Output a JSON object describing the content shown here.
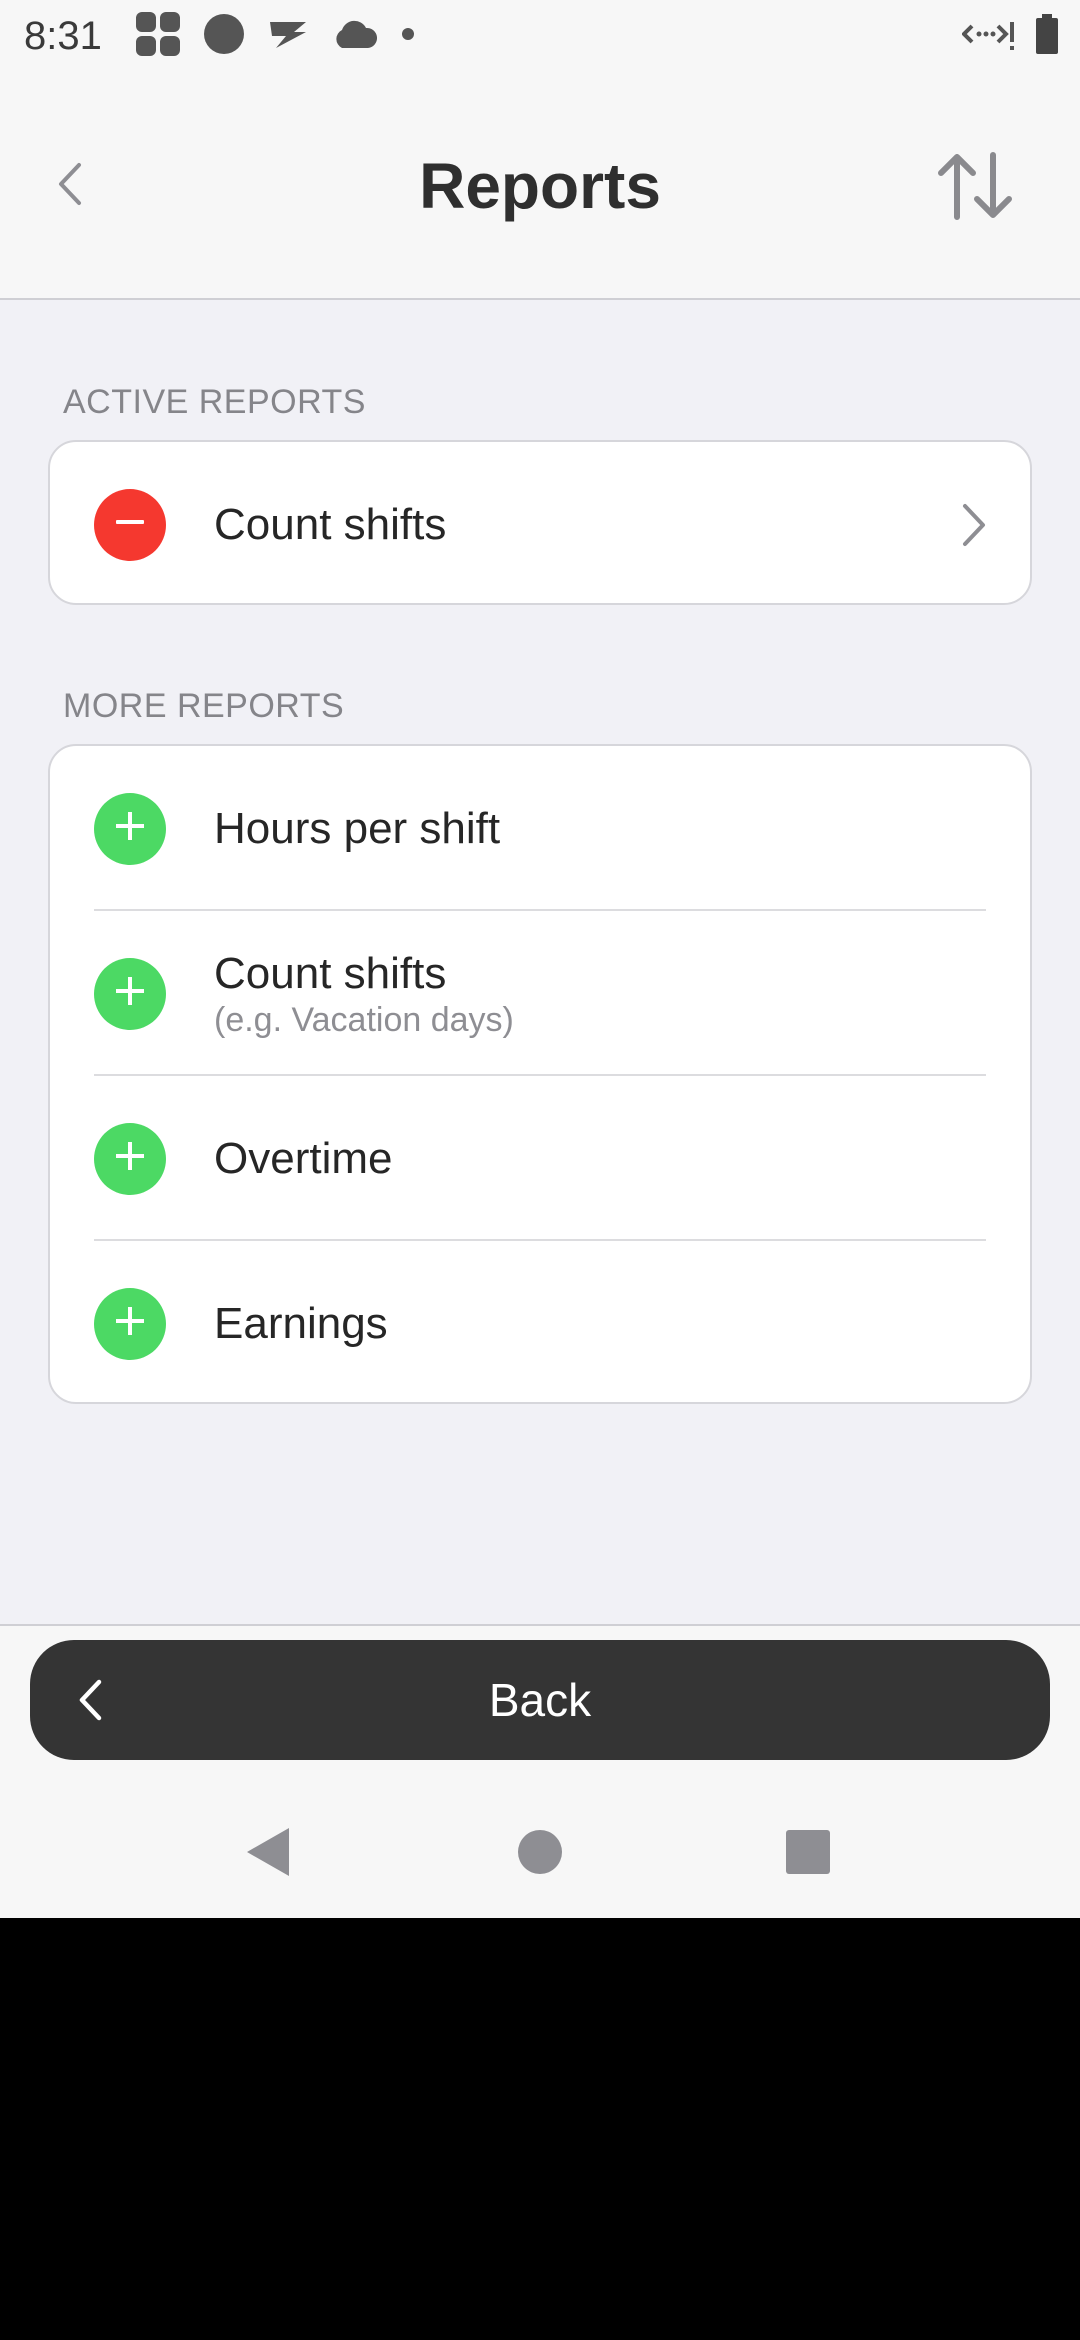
{
  "status_bar": {
    "time": "8:31",
    "left_icons": [
      "grid-app-icon",
      "circle-app-icon",
      "fast-forward-app-icon",
      "cloud-icon",
      "dot-icon"
    ],
    "right_icons": [
      "data-sync-icon",
      "battery-icon"
    ]
  },
  "header": {
    "title": "Reports",
    "back_icon": "chevron-left-icon",
    "sort_icon": "sort-arrows-icon"
  },
  "active_reports": {
    "label": "ACTIVE REPORTS",
    "items": [
      {
        "title": "Count shifts",
        "subtitle": "",
        "action": "remove"
      }
    ]
  },
  "more_reports": {
    "label": "MORE REPORTS",
    "items": [
      {
        "title": "Hours per shift",
        "subtitle": "",
        "action": "add"
      },
      {
        "title": "Count shifts",
        "subtitle": "(e.g. Vacation days)",
        "action": "add"
      },
      {
        "title": "Overtime",
        "subtitle": "",
        "action": "add"
      },
      {
        "title": "Earnings",
        "subtitle": "",
        "action": "add"
      }
    ]
  },
  "bottom": {
    "back_label": "Back"
  },
  "nav": {
    "back": "nav-back-icon",
    "home": "nav-home-icon",
    "recents": "nav-recents-icon"
  },
  "colors": {
    "remove": "#f5382f",
    "add": "#4cd964",
    "background": "#f1f1f6",
    "button_dark": "#343434"
  }
}
